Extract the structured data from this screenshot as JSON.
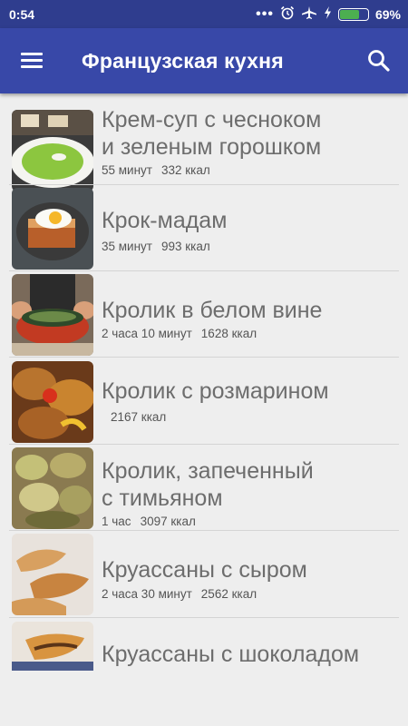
{
  "status_bar": {
    "time": "0:54",
    "icons": [
      "more-dots-icon",
      "alarm-icon",
      "airplane-mode-icon",
      "charging-icon",
      "battery-icon"
    ],
    "battery_level": 0.69,
    "battery_text": "69%"
  },
  "app_bar": {
    "title": "Французская кухня",
    "menu_icon": "hamburger-menu-icon",
    "search_icon": "search-icon"
  },
  "colors": {
    "status_bar": "#2f3d8e",
    "app_bar": "#3848a8",
    "background": "#eeeeee",
    "title_text": "#6d6d6d"
  },
  "recipes": [
    {
      "title": "Крем-суп с чесноком\nи зеленым горошком",
      "time": "55 минут",
      "kcal": "332 ккал",
      "image": "green pea soup"
    },
    {
      "title": "Крок-мадам",
      "time": "35 минут",
      "kcal": "993 ккал",
      "image": "croque madame"
    },
    {
      "title": "Кролик в белом вине",
      "time": "2 часа 10 минут",
      "kcal": "1628 ккал",
      "image": "rabbit in pot"
    },
    {
      "title": "Кролик с розмарином",
      "time": "",
      "kcal": "2167 ккал",
      "image": "roasted rabbit"
    },
    {
      "title": "Кролик, запеченный\nс тимьяном",
      "time": "1 час",
      "kcal": "3097 ккал",
      "image": "baked rabbit"
    },
    {
      "title": "Круассаны с сыром",
      "time": "2 часа 30 минут",
      "kcal": "2562 ккал",
      "image": "croissants"
    },
    {
      "title": "Круассаны с шоколадом",
      "time": "",
      "kcal": "",
      "image": "chocolate croissant"
    }
  ]
}
